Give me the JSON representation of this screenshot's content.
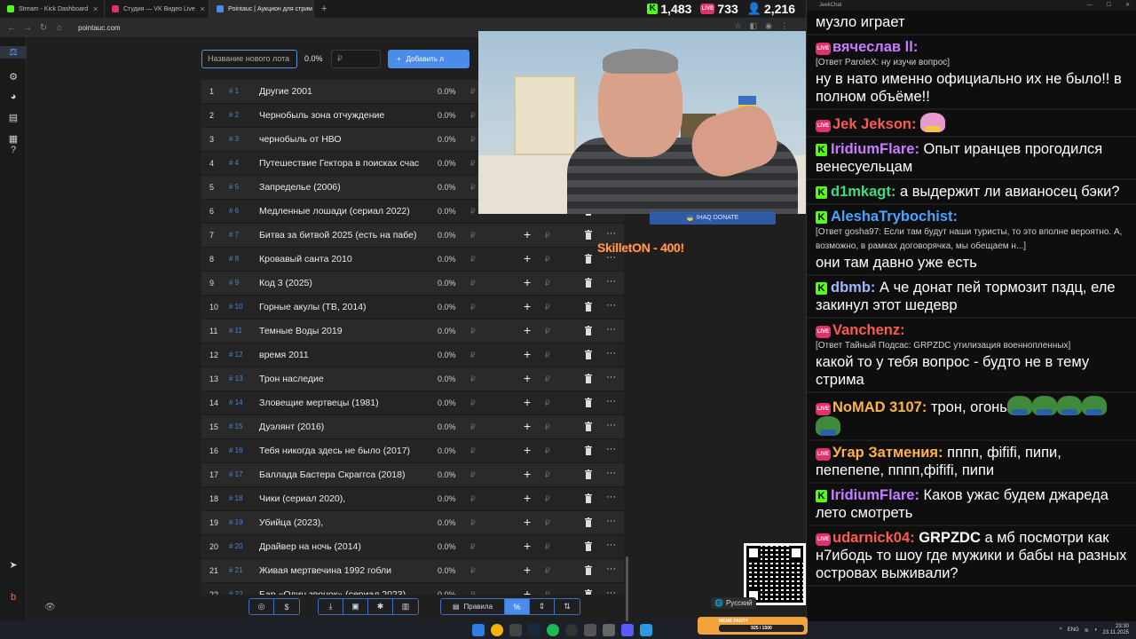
{
  "browser": {
    "tabs": [
      {
        "title": "Stream - Kick Dashboard",
        "color": "#53fc18"
      },
      {
        "title": "Студия — VK Видео Live",
        "color": "#e1306c"
      },
      {
        "title": "Pointauc | Аукцион для стрим",
        "color": "#4b8ce8",
        "active": true
      }
    ],
    "url": "pointauc.com"
  },
  "counters": {
    "kick": "1,483",
    "vk": "733",
    "viewers": "2,216"
  },
  "auction": {
    "new_lot_placeholder": "Название нового лота",
    "top_percent": "0.0%",
    "amount_placeholder": "₽",
    "add_button": "Добавить л",
    "rows": [
      {
        "num": "1",
        "id": "# 1",
        "title": "Другие 2001",
        "pct": "0.0%"
      },
      {
        "num": "2",
        "id": "# 2",
        "title": "Чернобыль зона отчуждение",
        "pct": "0.0%"
      },
      {
        "num": "3",
        "id": "# 3",
        "title": "чернобыль от НВО",
        "pct": "0.0%"
      },
      {
        "num": "4",
        "id": "# 4",
        "title": "Путешествие Гектора в поисках счас",
        "pct": "0.0%"
      },
      {
        "num": "5",
        "id": "# 5",
        "title": "Запределье (2006)",
        "pct": "0.0%"
      },
      {
        "num": "6",
        "id": "# 6",
        "title": "Медленные лошади (сериал 2022)",
        "pct": "0.0%"
      },
      {
        "num": "7",
        "id": "# 7",
        "title": "Битва за битвой 2025 (есть на пабе)",
        "pct": "0.0%"
      },
      {
        "num": "8",
        "id": "# 8",
        "title": "Кровавый санта 2010",
        "pct": "0.0%"
      },
      {
        "num": "9",
        "id": "# 9",
        "title": "Код 3 (2025)",
        "pct": "0.0%"
      },
      {
        "num": "10",
        "id": "# 10",
        "title": "Горные акулы (ТВ, 2014)",
        "pct": "0.0%"
      },
      {
        "num": "11",
        "id": "# 11",
        "title": "Темные Воды 2019",
        "pct": "0.0%"
      },
      {
        "num": "12",
        "id": "# 12",
        "title": "время 2011",
        "pct": "0.0%"
      },
      {
        "num": "13",
        "id": "# 13",
        "title": "Трон наследие",
        "pct": "0.0%"
      },
      {
        "num": "14",
        "id": "# 14",
        "title": "Зловещие мертвецы (1981)",
        "pct": "0.0%"
      },
      {
        "num": "15",
        "id": "# 15",
        "title": "Дуэлянт (2016)",
        "pct": "0.0%"
      },
      {
        "num": "16",
        "id": "# 16",
        "title": "Тебя никогда здесь не было (2017)",
        "pct": "0.0%"
      },
      {
        "num": "17",
        "id": "# 17",
        "title": "Баллада Бастера Скраггса (2018)",
        "pct": "0.0%"
      },
      {
        "num": "18",
        "id": "# 18",
        "title": "Чики (сериал 2020),",
        "pct": "0.0%"
      },
      {
        "num": "19",
        "id": "# 19",
        "title": "Убийца (2023),",
        "pct": "0.0%"
      },
      {
        "num": "20",
        "id": "# 20",
        "title": "Драйвер на ночь (2014)",
        "pct": "0.0%"
      },
      {
        "num": "21",
        "id": "# 21",
        "title": "Живая мертвечина 1992 гобли",
        "pct": "0.0%"
      },
      {
        "num": "22",
        "id": "# 22",
        "title": "Бар «Один звонок» (сериал 2023)",
        "pct": "0.0%"
      }
    ],
    "currency": "₽",
    "bottom": {
      "rules": "Правила",
      "percent": "%"
    }
  },
  "overlay": {
    "donate": "IHAQ DONATE",
    "alert": "SkilletON  - 400!",
    "language": "Русский"
  },
  "chat": {
    "app_title": "JeekChat",
    "messages": [
      {
        "platform": "none",
        "user": "",
        "user_color": "#ffffff",
        "reply": "",
        "text": "музло играет"
      },
      {
        "platform": "vk",
        "user": "вячеслав ll:",
        "user_color": "#c77dff",
        "reply": "[Ответ ParoleX: ну изучи вопрос]",
        "text": "ну в нато именно официально их не было!! в полном объёме!!"
      },
      {
        "platform": "vk",
        "user": "Jek Jekson:",
        "user_color": "#ff5a4f",
        "reply": "",
        "text": "",
        "emotes": [
          "pink"
        ]
      },
      {
        "platform": "kick",
        "user": "IridiumFlare:",
        "user_color": "#c77dff",
        "reply": "",
        "text": "Опыт иранцев прогодился венесуельцам"
      },
      {
        "platform": "kick",
        "user": "d1mkagt:",
        "user_color": "#3ddc84",
        "reply": "",
        "text": "а выдержит ли авианосец бэки?"
      },
      {
        "platform": "kick",
        "user": "AleshaTrybochist:",
        "user_color": "#4aa3ff",
        "reply": "[Ответ gosha97: Если там будут наши туристы, то это вполне вероятно. А, возможно, в рамках договорячка, мы обещаем н...]",
        "text": "они там давно уже есть"
      },
      {
        "platform": "kick",
        "user": "dbmb:",
        "user_color": "#a0b8ff",
        "reply": "",
        "text": "А че донат пей тормозит пздц, еле закинул этот шедевр"
      },
      {
        "platform": "vk",
        "user": "Vanchenz:",
        "user_color": "#ff5a4f",
        "reply": "[Ответ Тайный Подсас: GRPZDC утилизация военнопленных]",
        "text": "какой то у тебя вопрос - будто не в тему стрима"
      },
      {
        "platform": "vk",
        "user": "NoMAD 3107:",
        "user_color": "#ffb347",
        "reply": "",
        "text": "трон, огонь",
        "emotes": [
          "pepe",
          "pepe",
          "pepe",
          "pepe",
          "pepe"
        ]
      },
      {
        "platform": "vk",
        "user": "Угар Затмения:",
        "user_color": "#ffb347",
        "reply": "",
        "text": "пппп, фififi, пипи, пепепепе, пппп,фififi, пипи"
      },
      {
        "platform": "kick",
        "user": "IridiumFlare:",
        "user_color": "#c77dff",
        "reply": "",
        "text": "Каков ужас будем джареда лето смотреть"
      },
      {
        "platform": "vk",
        "user": "udarnick04:",
        "user_color": "#ff5a4f",
        "reply": "",
        "text_bold": "GRPZDC",
        "text": " а мб посмотри как н7ибодь то шоу где мужики и бабы на разных островах выживали?"
      }
    ]
  },
  "meme_party": {
    "title": "MEME PARTY",
    "progress_text": "925 / 1500"
  },
  "tray": {
    "lang": "ENG",
    "time": "23:30",
    "date": "23.11.2025"
  }
}
